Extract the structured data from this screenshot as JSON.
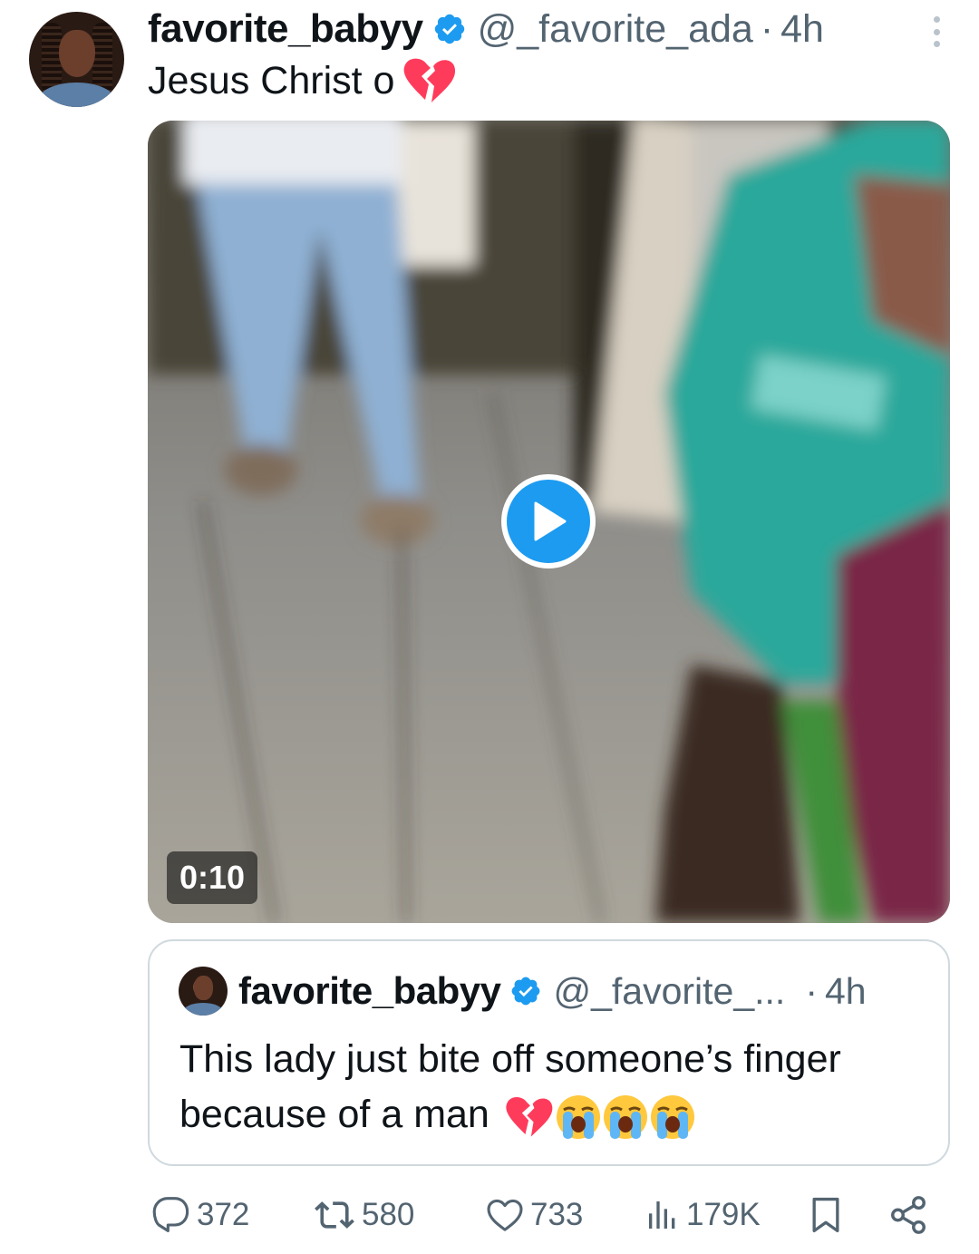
{
  "post": {
    "display_name": "favorite_babyy",
    "handle": "@_favorite_ada",
    "separator": "·",
    "time": "4h",
    "text": "Jesus Christ o",
    "text_emoji": "broken-heart"
  },
  "media": {
    "duration": "0:10"
  },
  "quoted_post": {
    "display_name": "favorite_babyy",
    "handle": "@_favorite_...",
    "separator": "·",
    "time": "4h",
    "text": "This lady just bite off someone’s finger because of a man",
    "text_emojis": [
      "broken-heart",
      "loudly-crying-face",
      "loudly-crying-face",
      "loudly-crying-face"
    ]
  },
  "actions": {
    "replies": "372",
    "reposts": "580",
    "likes": "733",
    "views": "179K"
  },
  "colors": {
    "accent": "#1d9bf0",
    "text": "#0f1419",
    "secondary": "#536471",
    "border": "#cfd9de"
  }
}
